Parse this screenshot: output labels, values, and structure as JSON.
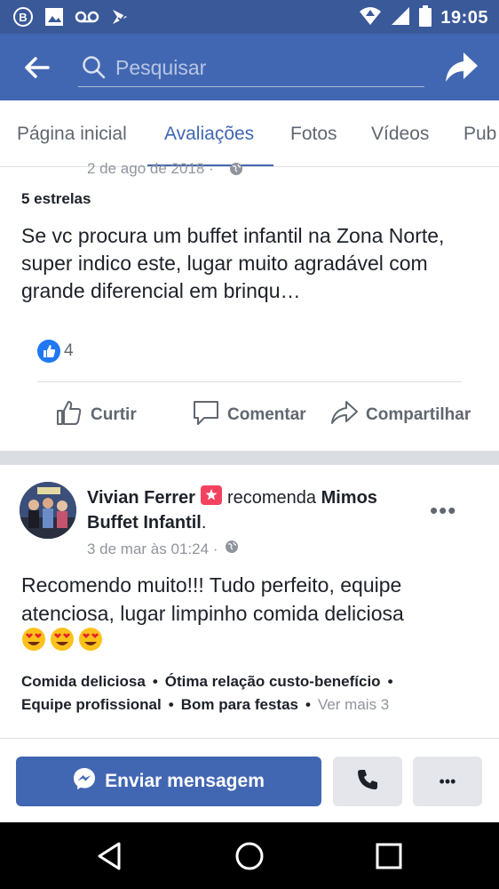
{
  "status_bar": {
    "time": "19:05",
    "icons": [
      "b-notification-icon",
      "image-icon",
      "voicemail-icon",
      "check-badge-icon",
      "wifi-icon",
      "signal-icon",
      "battery-icon"
    ]
  },
  "app_bar": {
    "search_placeholder": "Pesquisar",
    "icons": [
      "back-arrow-icon",
      "search-icon",
      "share-arrow-icon"
    ]
  },
  "tabs": [
    {
      "label": "Página inicial",
      "active": false
    },
    {
      "label": "Avaliações",
      "active": true
    },
    {
      "label": "Fotos",
      "active": false
    },
    {
      "label": "Vídeos",
      "active": false
    },
    {
      "label": "Pub",
      "active": false
    }
  ],
  "review1": {
    "date": "2 de ago de 2018 ·",
    "rating": "5 estrelas",
    "text": "Se vc procura um buffet infantil na Zona Norte, super indico este, lugar muito agradável com grande diferencial em brinqu…",
    "like_count": "4",
    "actions": {
      "like": "Curtir",
      "comment": "Comentar",
      "share": "Compartilhar"
    }
  },
  "review2": {
    "author": "Vivian Ferrer",
    "verb": "recomenda",
    "page": "Mimos Buffet Infantil",
    "period": ".",
    "date": "3 de mar às 01:24 ·",
    "text": "Recomendo muito!!! Tudo perfeito, equipe atenciosa, lugar limpinho comida deliciosa",
    "emoji_count": 3,
    "tags": [
      "Comida deliciosa",
      "Ótima relação custo-benefício",
      "Equipe profissional",
      "Bom para festas"
    ],
    "more_tags": "Ver mais 3",
    "separator": "•"
  },
  "bottom_bar": {
    "message_label": "Enviar mensagem",
    "menu_label": "•••"
  },
  "colors": {
    "brand": "#4267b2",
    "status_bar": "#3a5999",
    "like_blue": "#2078f4",
    "recommend_badge": "#f3425f"
  }
}
